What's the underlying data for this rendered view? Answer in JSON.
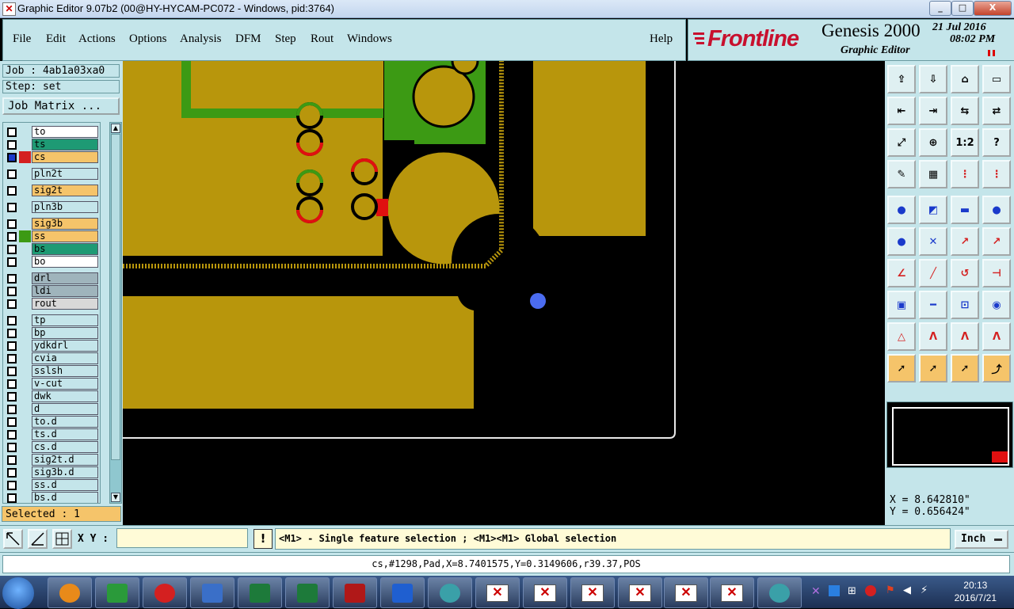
{
  "window": {
    "title": "Graphic Editor 9.07b2 (00@HY-HYCAM-PC072 - Windows, pid:3764)",
    "minimize_glyph": "_",
    "maximize_glyph": "□",
    "close_glyph": "X"
  },
  "menu": {
    "items": [
      "File",
      "Edit",
      "Actions",
      "Options",
      "Analysis",
      "DFM",
      "Step",
      "Rout",
      "Windows"
    ],
    "help": "Help"
  },
  "brand": {
    "logo": "Frontline",
    "product": "Genesis 2000",
    "subtitle": "Graphic Editor",
    "date": "21 Jul 2016",
    "time": "08:02 PM"
  },
  "job": {
    "job_label": "Job : 4ab1a03xa0",
    "step_label": "Step: set",
    "matrix_button": "Job Matrix ..."
  },
  "layers": [
    {
      "name": "to",
      "color": "#ffffff"
    },
    {
      "name": "ts",
      "color": "#1e9a74"
    },
    {
      "name": "cs",
      "color": "#f5c46a"
    },
    {
      "name": "pln2t",
      "color": "#c4e5ea"
    },
    {
      "name": "sig2t",
      "color": "#f5c46a"
    },
    {
      "name": "pln3b",
      "color": "#c4e5ea"
    },
    {
      "name": "sig3b",
      "color": "#f5c46a"
    },
    {
      "name": "ss",
      "color": "#f5c46a"
    },
    {
      "name": "bs",
      "color": "#1e9a74"
    },
    {
      "name": "bo",
      "color": "#ffffff"
    },
    {
      "name": "drl",
      "color": "#9fb4bc"
    },
    {
      "name": "ldi",
      "color": "#9fb4bc"
    },
    {
      "name": "rout",
      "color": "#d8d8d8"
    },
    {
      "name": "tp",
      "color": "#c4e5ea"
    },
    {
      "name": "bp",
      "color": "#c4e5ea"
    },
    {
      "name": "ydkdrl",
      "color": "#c4e5ea"
    },
    {
      "name": "cvia",
      "color": "#c4e5ea"
    },
    {
      "name": "sslsh",
      "color": "#c4e5ea"
    },
    {
      "name": "v-cut",
      "color": "#c4e5ea"
    },
    {
      "name": "dwk",
      "color": "#c4e5ea"
    },
    {
      "name": "d",
      "color": "#c4e5ea"
    },
    {
      "name": "to.d",
      "color": "#c4e5ea"
    },
    {
      "name": "ts.d",
      "color": "#c4e5ea"
    },
    {
      "name": "cs.d",
      "color": "#c4e5ea"
    },
    {
      "name": "sig2t.d",
      "color": "#c4e5ea"
    },
    {
      "name": "sig3b.d",
      "color": "#c4e5ea"
    },
    {
      "name": "ss.d",
      "color": "#c4e5ea"
    },
    {
      "name": "bs.d",
      "color": "#c4e5ea"
    }
  ],
  "selected_label": "Selected : 1",
  "coords": {
    "x": "X = 8.642810\"",
    "y": "Y = 0.656424\""
  },
  "tool_rows": [
    [
      "⇪",
      "⇩",
      "⌂",
      "▭"
    ],
    [
      "⇤",
      "⇥",
      "⇆",
      "⇄"
    ],
    [
      "⤢",
      "⊕",
      "1:2",
      "?"
    ],
    [
      "✎",
      "▦",
      "⋮",
      "⋮"
    ],
    [
      "●",
      "◩",
      "▬",
      "●"
    ],
    [
      "●",
      "✕",
      "↗",
      "↗"
    ],
    [
      "∠",
      "╱",
      "↺",
      "⊣"
    ],
    [
      "▣",
      "━",
      "⊡",
      "◉"
    ],
    [
      "△",
      "Λ",
      "Λ",
      "Λ"
    ],
    [
      "➚",
      "➚",
      "➚",
      "⤴"
    ]
  ],
  "bottom": {
    "xy_label": "X Y :",
    "xy_value": "",
    "warn": "!",
    "hint": "<M1> - Single feature selection ; <M1><M1> Global selection",
    "unit": "Inch"
  },
  "status": "cs,#1298,Pad,X=8.7401575,Y=0.3149606,r39.37,POS",
  "taskbar": {
    "time": "20:13",
    "date": "2016/7/21"
  },
  "colors": {
    "copper": "#b8960c",
    "green": "#3c9a14",
    "panel": "#c4e5ea",
    "cursor": "#4b6cf0",
    "red": "#e01010"
  }
}
